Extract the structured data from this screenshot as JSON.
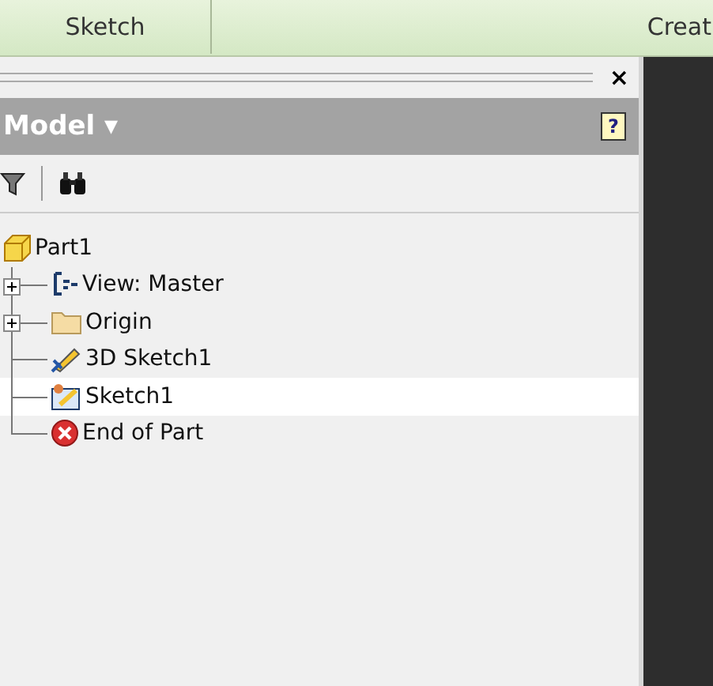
{
  "ribbon_tabs": [
    {
      "label": "Sketch"
    },
    {
      "label": "Creat"
    }
  ],
  "panel": {
    "close": "×",
    "title": "Model ▾",
    "help": "?"
  },
  "tree": {
    "label": "Part1",
    "kind": "part",
    "children": [
      {
        "label": "View: Master",
        "kind": "view",
        "expanded": false,
        "selected": false
      },
      {
        "label": "Origin",
        "kind": "folder",
        "expanded": false,
        "selected": false
      },
      {
        "label": "3D Sketch1",
        "kind": "sketch3d",
        "selected": false
      },
      {
        "label": "Sketch1",
        "kind": "sketch",
        "selected": true
      },
      {
        "label": "End of Part",
        "kind": "end",
        "selected": false
      }
    ]
  }
}
